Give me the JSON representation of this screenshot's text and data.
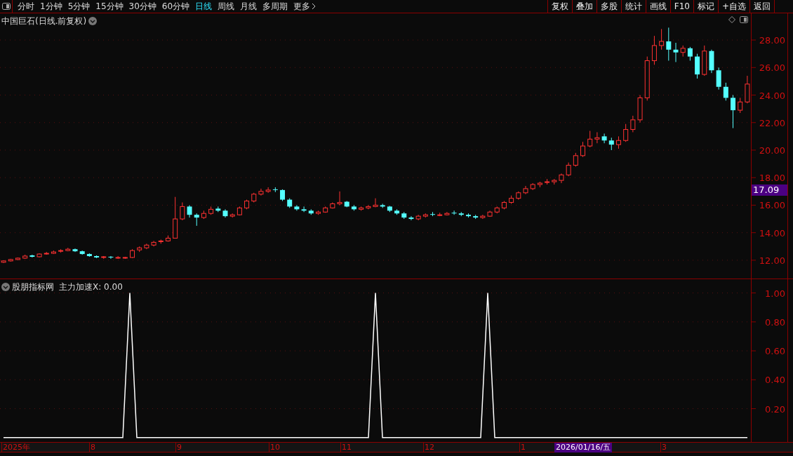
{
  "toolbar": {
    "tabs": [
      {
        "label": "分时",
        "selected": false
      },
      {
        "label": "1分钟",
        "selected": false
      },
      {
        "label": "5分钟",
        "selected": false
      },
      {
        "label": "15分钟",
        "selected": false
      },
      {
        "label": "30分钟",
        "selected": false
      },
      {
        "label": "60分钟",
        "selected": false
      },
      {
        "label": "日线",
        "selected": true
      },
      {
        "label": "周线",
        "selected": false
      },
      {
        "label": "月线",
        "selected": false
      },
      {
        "label": "多周期",
        "selected": false
      },
      {
        "label": "更多",
        "selected": false
      }
    ],
    "buttons": [
      "复权",
      "叠加",
      "多股",
      "统计",
      "画线",
      "F10",
      "标记",
      "+自选",
      "返回"
    ]
  },
  "main_chart": {
    "title": "中国巨石(日线.前复权)",
    "price_tag": "17.09",
    "chart_data": {
      "type": "candlestick",
      "grid": true,
      "ylim": [
        10.67,
        29.94
      ],
      "yticks": [
        {
          "value": 28,
          "label": "28.00"
        },
        {
          "value": 26,
          "label": "26.00"
        },
        {
          "value": 24,
          "label": "24.00"
        },
        {
          "value": 22,
          "label": "22.00"
        },
        {
          "value": 20,
          "label": "20.00"
        },
        {
          "value": 18,
          "label": "18.00"
        },
        {
          "value": 16,
          "label": "16.00"
        },
        {
          "value": 14,
          "label": "14.00"
        },
        {
          "value": 12,
          "label": "12.00"
        }
      ],
      "ohlc": [
        [
          11.85,
          12.0,
          11.8,
          11.95
        ],
        [
          11.95,
          12.1,
          11.9,
          12.05
        ],
        [
          12.05,
          12.2,
          12.0,
          12.15
        ],
        [
          12.15,
          12.4,
          12.1,
          12.3
        ],
        [
          12.35,
          12.4,
          12.2,
          12.25
        ],
        [
          12.25,
          12.5,
          12.2,
          12.45
        ],
        [
          12.45,
          12.6,
          12.4,
          12.5
        ],
        [
          12.5,
          12.7,
          12.45,
          12.6
        ],
        [
          12.65,
          12.8,
          12.55,
          12.7
        ],
        [
          12.7,
          12.9,
          12.65,
          12.8
        ],
        [
          12.8,
          12.85,
          12.6,
          12.65
        ],
        [
          12.65,
          12.7,
          12.4,
          12.45
        ],
        [
          12.45,
          12.5,
          12.25,
          12.3
        ],
        [
          12.3,
          12.35,
          12.15,
          12.2
        ],
        [
          12.2,
          12.3,
          12.1,
          12.25
        ],
        [
          12.25,
          12.3,
          12.1,
          12.2
        ],
        [
          12.15,
          12.3,
          12.1,
          12.2
        ],
        [
          12.2,
          12.25,
          12.1,
          12.2
        ],
        [
          12.2,
          12.8,
          12.15,
          12.7
        ],
        [
          12.75,
          13.0,
          12.6,
          12.9
        ],
        [
          12.9,
          13.2,
          12.8,
          13.1
        ],
        [
          13.1,
          13.4,
          13.0,
          13.3
        ],
        [
          13.35,
          13.5,
          13.2,
          13.4
        ],
        [
          13.4,
          13.8,
          13.35,
          13.6
        ],
        [
          13.6,
          16.6,
          13.6,
          15.0
        ],
        [
          15.0,
          16.2,
          14.9,
          15.9
        ],
        [
          15.9,
          16.0,
          15.1,
          15.3
        ],
        [
          15.3,
          15.4,
          14.5,
          15.1
        ],
        [
          15.1,
          15.6,
          15.0,
          15.4
        ],
        [
          15.4,
          15.9,
          15.3,
          15.7
        ],
        [
          15.75,
          15.9,
          15.5,
          15.6
        ],
        [
          15.6,
          15.7,
          15.1,
          15.2
        ],
        [
          15.2,
          15.4,
          15.1,
          15.3
        ],
        [
          15.3,
          15.9,
          15.25,
          15.8
        ],
        [
          15.8,
          16.4,
          15.7,
          16.3
        ],
        [
          16.3,
          16.9,
          16.2,
          16.8
        ],
        [
          16.8,
          17.2,
          16.7,
          17.0
        ],
        [
          17.0,
          17.3,
          16.9,
          17.1
        ],
        [
          17.15,
          17.3,
          16.95,
          17.1
        ],
        [
          17.1,
          17.15,
          16.3,
          16.4
        ],
        [
          16.4,
          16.5,
          15.8,
          15.9
        ],
        [
          15.9,
          16.0,
          15.6,
          15.7
        ],
        [
          15.7,
          15.9,
          15.5,
          15.6
        ],
        [
          15.6,
          15.7,
          15.3,
          15.4
        ],
        [
          15.4,
          15.6,
          15.3,
          15.5
        ],
        [
          15.5,
          15.9,
          15.45,
          15.8
        ],
        [
          15.8,
          16.2,
          15.75,
          16.1
        ],
        [
          16.1,
          17.0,
          16.0,
          16.2
        ],
        [
          16.25,
          16.3,
          15.85,
          15.9
        ],
        [
          15.9,
          16.0,
          15.6,
          15.7
        ],
        [
          15.7,
          15.9,
          15.6,
          15.8
        ],
        [
          15.8,
          16.0,
          15.7,
          15.9
        ],
        [
          15.9,
          16.5,
          15.85,
          16.0
        ],
        [
          16.0,
          16.1,
          15.8,
          15.9
        ],
        [
          15.9,
          15.95,
          15.5,
          15.6
        ],
        [
          15.6,
          15.7,
          15.3,
          15.4
        ],
        [
          15.4,
          15.5,
          15.0,
          15.1
        ],
        [
          15.1,
          15.2,
          14.9,
          15.0
        ],
        [
          15.0,
          15.3,
          14.9,
          15.2
        ],
        [
          15.2,
          15.4,
          15.1,
          15.3
        ],
        [
          15.35,
          15.5,
          15.2,
          15.3
        ],
        [
          15.3,
          15.45,
          15.2,
          15.3
        ],
        [
          15.3,
          15.5,
          15.25,
          15.4
        ],
        [
          15.45,
          15.6,
          15.3,
          15.4
        ],
        [
          15.4,
          15.5,
          15.2,
          15.3
        ],
        [
          15.3,
          15.4,
          15.1,
          15.2
        ],
        [
          15.2,
          15.3,
          15.0,
          15.1
        ],
        [
          15.1,
          15.3,
          15.0,
          15.2
        ],
        [
          15.2,
          15.6,
          15.15,
          15.5
        ],
        [
          15.5,
          15.9,
          15.4,
          15.8
        ],
        [
          15.8,
          16.3,
          15.7,
          16.2
        ],
        [
          16.2,
          16.7,
          16.1,
          16.5
        ],
        [
          16.5,
          17.0,
          16.4,
          16.9
        ],
        [
          16.9,
          17.4,
          16.8,
          17.2
        ],
        [
          17.2,
          17.6,
          17.1,
          17.5
        ],
        [
          17.5,
          17.7,
          17.3,
          17.6
        ],
        [
          17.65,
          17.9,
          17.5,
          17.7
        ],
        [
          17.7,
          17.9,
          17.5,
          17.8
        ],
        [
          17.8,
          18.3,
          17.6,
          18.2
        ],
        [
          18.2,
          19.1,
          18.1,
          18.9
        ],
        [
          18.9,
          19.8,
          18.8,
          19.6
        ],
        [
          19.6,
          20.6,
          19.5,
          20.3
        ],
        [
          20.3,
          21.4,
          20.2,
          20.8
        ],
        [
          20.8,
          21.3,
          20.5,
          20.9
        ],
        [
          21.0,
          21.2,
          20.5,
          20.7
        ],
        [
          20.7,
          20.9,
          20.0,
          20.4
        ],
        [
          20.4,
          21.0,
          20.1,
          20.7
        ],
        [
          20.7,
          21.9,
          20.6,
          21.5
        ],
        [
          21.5,
          22.5,
          21.3,
          22.2
        ],
        [
          22.2,
          24.0,
          22.0,
          23.8
        ],
        [
          23.8,
          26.8,
          23.6,
          26.5
        ],
        [
          26.5,
          28.3,
          26.2,
          27.6
        ],
        [
          27.6,
          28.8,
          27.3,
          27.9
        ],
        [
          27.9,
          28.9,
          26.5,
          27.3
        ],
        [
          27.3,
          27.8,
          26.4,
          27.1
        ],
        [
          27.1,
          27.6,
          26.8,
          27.4
        ],
        [
          27.4,
          27.5,
          26.5,
          26.8
        ],
        [
          26.8,
          27.0,
          25.2,
          25.5
        ],
        [
          25.5,
          27.6,
          25.4,
          27.2
        ],
        [
          27.2,
          27.3,
          25.6,
          25.8
        ],
        [
          25.8,
          26.0,
          24.4,
          24.6
        ],
        [
          24.6,
          24.9,
          23.6,
          23.8
        ],
        [
          23.8,
          24.0,
          21.6,
          22.9
        ],
        [
          22.9,
          23.8,
          22.7,
          23.5
        ],
        [
          23.5,
          25.4,
          23.4,
          24.8
        ]
      ]
    }
  },
  "indicator": {
    "name": "股朋指标网",
    "reading": "主力加速X: 0.00",
    "chart_data": {
      "type": "line",
      "grid": true,
      "ylim": [
        -0.03,
        1.095
      ],
      "yticks": [
        {
          "value": 0.2,
          "label": "0.20"
        },
        {
          "value": 0.4,
          "label": "0.40"
        },
        {
          "value": 0.6,
          "label": "0.60"
        },
        {
          "value": 0.8,
          "label": "0.80"
        },
        {
          "value": 1.0,
          "label": "1.00"
        }
      ],
      "series": [
        {
          "color": "#ffffff",
          "values": [
            0,
            0,
            0,
            0,
            0,
            0,
            0,
            0,
            0,
            0,
            0,
            0,
            0,
            0,
            0,
            0,
            0,
            0,
            1,
            0,
            0,
            0,
            0,
            0,
            0,
            0,
            0,
            0,
            0,
            0,
            0,
            0,
            0,
            0,
            0,
            0,
            0,
            0,
            0,
            0,
            0,
            0,
            0,
            0,
            0,
            0,
            0,
            0,
            0,
            0,
            0,
            0,
            0,
            1,
            0,
            0,
            0,
            0,
            0,
            0,
            0,
            0,
            0,
            0,
            0,
            0,
            0,
            0,
            0,
            1,
            0,
            0,
            0,
            0,
            0,
            0,
            0,
            0,
            0,
            0,
            0,
            0,
            0,
            0,
            0,
            0,
            0,
            0,
            0,
            0,
            0,
            0,
            0,
            0,
            0,
            0,
            0,
            0,
            0,
            0,
            0,
            0,
            0,
            0,
            0,
            0,
            0
          ]
        }
      ]
    }
  },
  "x_axis": {
    "labels": [
      {
        "text": "2025年",
        "kind": "month"
      },
      {
        "text": "8",
        "kind": "month"
      },
      {
        "text": "9",
        "kind": "month"
      },
      {
        "text": "10",
        "kind": "month"
      },
      {
        "text": "11",
        "kind": "month"
      },
      {
        "text": "12",
        "kind": "month"
      },
      {
        "text": "1",
        "kind": "month"
      },
      {
        "text": "2026/01/16/五",
        "kind": "cursor"
      },
      {
        "text": "3",
        "kind": "month"
      }
    ]
  }
}
